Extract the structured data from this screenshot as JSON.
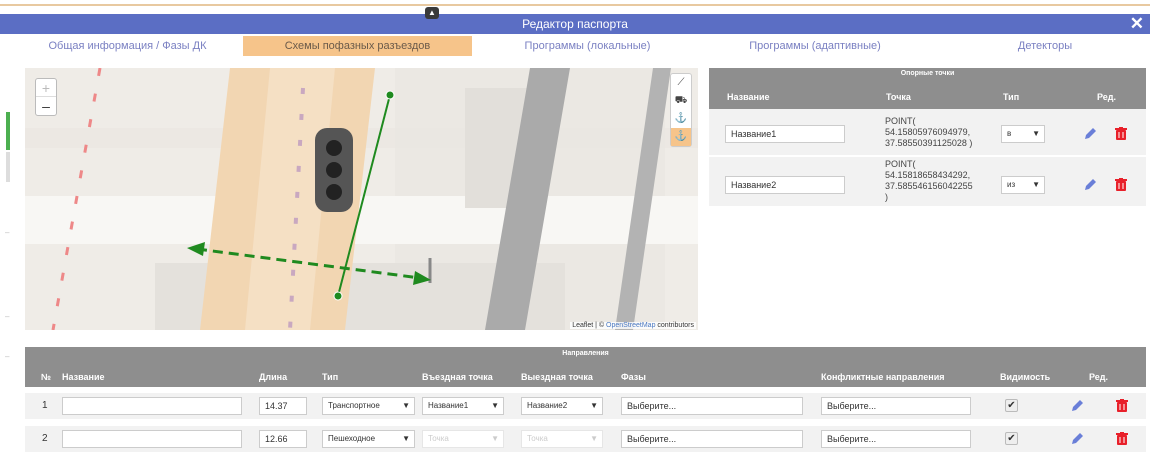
{
  "window": {
    "title": "Редактор паспорта",
    "close_icon": "close-icon",
    "collapse_icon": "chevron-up-icon"
  },
  "tabs": [
    {
      "label": "Общая информация / Фазы ДК",
      "active": false
    },
    {
      "label": "Схемы пофазных разъездов",
      "active": true
    },
    {
      "label": "Программы (локальные)",
      "active": false
    },
    {
      "label": "Программы (адаптивные)",
      "active": false
    },
    {
      "label": "Детекторы",
      "active": false
    }
  ],
  "map": {
    "zoom_in": "+",
    "zoom_out": "–",
    "tools": [
      "draw-line-icon",
      "car-icon",
      "anchor-icon",
      "anchor-add-icon"
    ],
    "attribution_prefix": "Leaflet | © ",
    "attribution_link": "OpenStreetMap",
    "attribution_suffix": " contributors"
  },
  "anchor_points": {
    "caption": "Опорные точки",
    "headers": {
      "name": "Название",
      "point": "Точка",
      "type": "Тип",
      "edit": "Ред."
    },
    "rows": [
      {
        "name": "Название1",
        "point_lines": [
          "POINT(",
          "54.15805976094979,",
          "37.58550391125028 )"
        ],
        "type": "в"
      },
      {
        "name": "Название2",
        "point_lines": [
          "POINT(",
          "54.15818658434292,",
          "37.585546156042255",
          ")"
        ],
        "type": "из"
      }
    ]
  },
  "directions": {
    "caption": "Направления",
    "headers": {
      "num": "№",
      "name": "Название",
      "length": "Длина",
      "type": "Тип",
      "entry": "Въездная точка",
      "exit": "Выездная точка",
      "phases": "Фазы",
      "conflicts": "Конфликтные направления",
      "visibility": "Видимость",
      "edit": "Ред."
    },
    "rows": [
      {
        "num": "1",
        "name": "",
        "length": "14.37",
        "type": "Транспортное",
        "entry": "Название1",
        "exit": "Название2",
        "entry_disabled": false,
        "exit_disabled": false,
        "phases": "Выберите...",
        "conflicts": "Выберите...",
        "visible": true
      },
      {
        "num": "2",
        "name": "",
        "length": "12.66",
        "type": "Пешеходное",
        "entry": "Точка",
        "exit": "Точка",
        "entry_disabled": true,
        "exit_disabled": true,
        "phases": "Выберите...",
        "conflicts": "Выберите...",
        "visible": true
      }
    ]
  },
  "colors": {
    "titlebar": "#5b6ec4",
    "active_tab": "#f6c48a",
    "table_header": "#8e8e8e",
    "route_line": "#1f8a1f",
    "edit_icon": "#6a7fd8",
    "delete_icon": "#e8202a"
  }
}
